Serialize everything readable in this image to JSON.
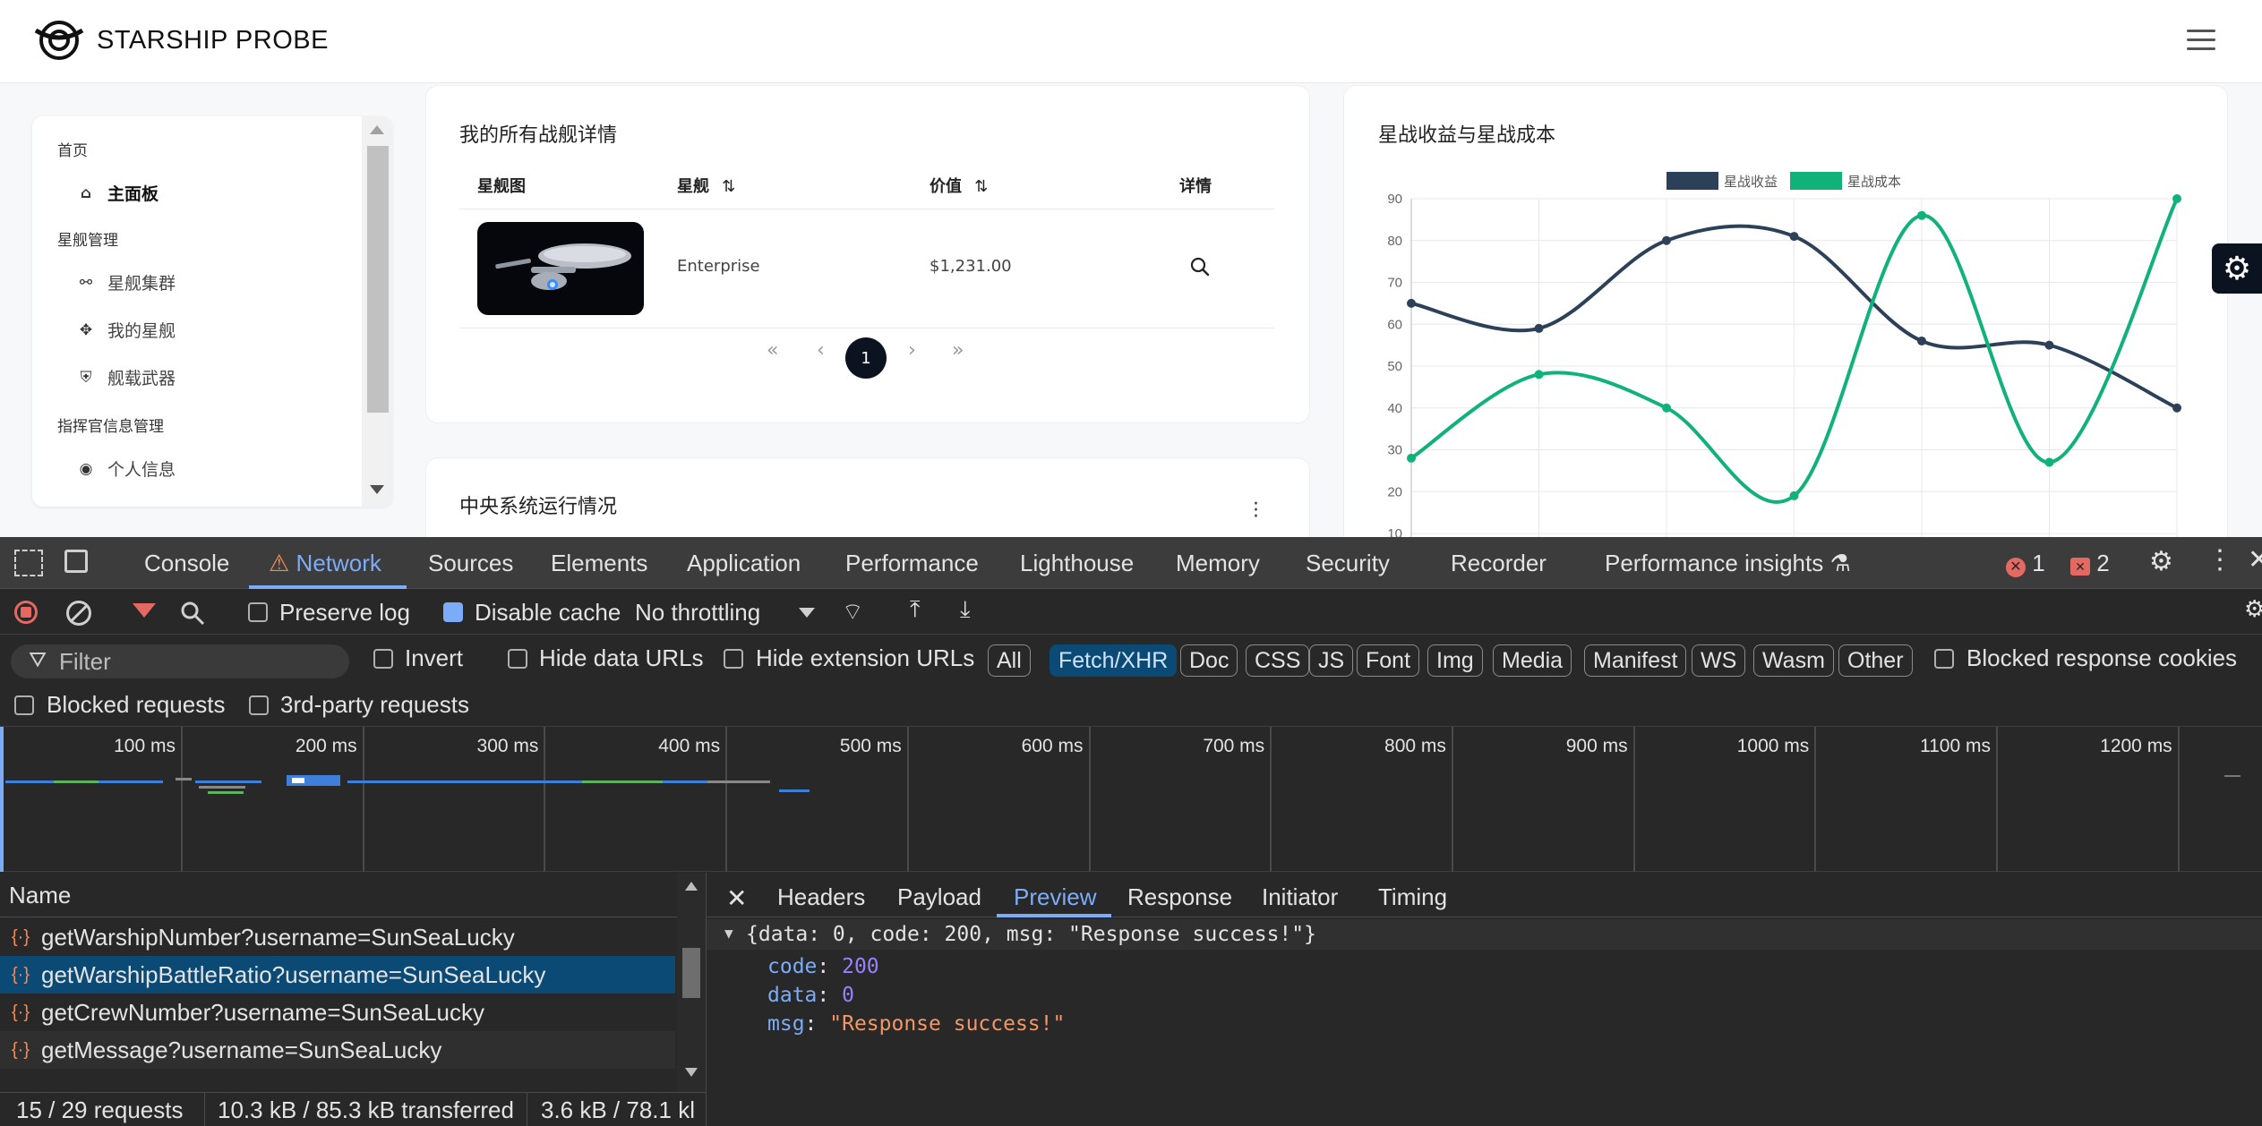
{
  "app": {
    "brand": "STARSHIP PROBE",
    "sidebar": {
      "groups": [
        {
          "label": "首页",
          "items": [
            {
              "label": "主面板",
              "icon": "home-icon",
              "active": true
            }
          ]
        },
        {
          "label": "星舰管理",
          "items": [
            {
              "label": "星舰集群",
              "icon": "cluster-icon"
            },
            {
              "label": "我的星舰",
              "icon": "ship-icon"
            },
            {
              "label": "舰载武器",
              "icon": "weapon-icon"
            }
          ]
        },
        {
          "label": "指挥官信息管理",
          "items": [
            {
              "label": "个人信息",
              "icon": "eye-icon"
            }
          ]
        }
      ]
    },
    "warships_card": {
      "title": "我的所有战舰详情",
      "columns": [
        "星舰图",
        "星舰",
        "价值",
        "详情"
      ],
      "sort_icon": "⇅",
      "rows": [
        {
          "name": "Enterprise",
          "value": "$1,231.00"
        }
      ],
      "pagination": {
        "first": "«",
        "prev": "‹",
        "current": "1",
        "next": "›",
        "last": "»"
      }
    },
    "system_card": {
      "title": "中央系统运行情况"
    },
    "chart_card": {
      "title": "星战收益与星战成本"
    }
  },
  "chart_data": {
    "type": "line",
    "title": "星战收益与星战成本",
    "categories": [
      "",
      "",
      "",
      "",
      "",
      "",
      ""
    ],
    "series": [
      {
        "name": "星战收益",
        "color": "#2c4159",
        "values": [
          65,
          59,
          80,
          81,
          56,
          55,
          40
        ]
      },
      {
        "name": "星战成本",
        "color": "#10b27a",
        "values": [
          28,
          48,
          40,
          19,
          86,
          27,
          90
        ]
      }
    ],
    "yticks": [
      "90",
      "80",
      "70",
      "60",
      "50",
      "40",
      "30",
      "20",
      "10"
    ],
    "ylim": [
      10,
      90
    ],
    "grid": true,
    "legend": "top",
    "curve": "smooth"
  },
  "devtools": {
    "tabs": [
      "Console",
      "Network",
      "Sources",
      "Elements",
      "Application",
      "Performance",
      "Lighthouse",
      "Memory",
      "Security",
      "Recorder",
      "Performance insights"
    ],
    "active_tab": "Network",
    "errors": "1",
    "issues": "2",
    "toolbar": {
      "preserve_log": "Preserve log",
      "disable_cache": "Disable cache",
      "throttling": "No throttling"
    },
    "filter": {
      "placeholder": "Filter",
      "invert": "Invert",
      "hide_data_urls": "Hide data URLs",
      "hide_extension_urls": "Hide extension URLs",
      "chips": [
        "All",
        "Fetch/XHR",
        "Doc",
        "CSS",
        "JS",
        "Font",
        "Img",
        "Media",
        "Manifest",
        "WS",
        "Wasm",
        "Other"
      ],
      "selected_chip": "Fetch/XHR",
      "blocked_response_cookies": "Blocked response cookies",
      "blocked_requests": "Blocked requests",
      "third_party": "3rd-party requests"
    },
    "timeline_ticks": [
      "100 ms",
      "200 ms",
      "300 ms",
      "400 ms",
      "500 ms",
      "600 ms",
      "700 ms",
      "800 ms",
      "900 ms",
      "1000 ms",
      "1100 ms",
      "1200 ms"
    ],
    "requests_header": "Name",
    "requests": [
      "getWarshipNumber?username=SunSeaLucky",
      "getWarshipBattleRatio?username=SunSeaLucky",
      "getCrewNumber?username=SunSeaLucky",
      "getMessage?username=SunSeaLucky"
    ],
    "selected_request": 1,
    "status": {
      "requests": "15 / 29 requests",
      "transferred": "10.3 kB / 85.3 kB transferred",
      "resources": "3.6 kB / 78.1 kl"
    },
    "detail_tabs": [
      "Headers",
      "Payload",
      "Preview",
      "Response",
      "Initiator",
      "Timing"
    ],
    "detail_active": "Preview",
    "preview": {
      "summary": "{data: 0, code: 200, msg: \"Response success!\"}",
      "fields": [
        {
          "key": "code",
          "value": "200",
          "kind": "number"
        },
        {
          "key": "data",
          "value": "0",
          "kind": "number"
        },
        {
          "key": "msg",
          "value": "\"Response success!\"",
          "kind": "string"
        }
      ]
    }
  }
}
